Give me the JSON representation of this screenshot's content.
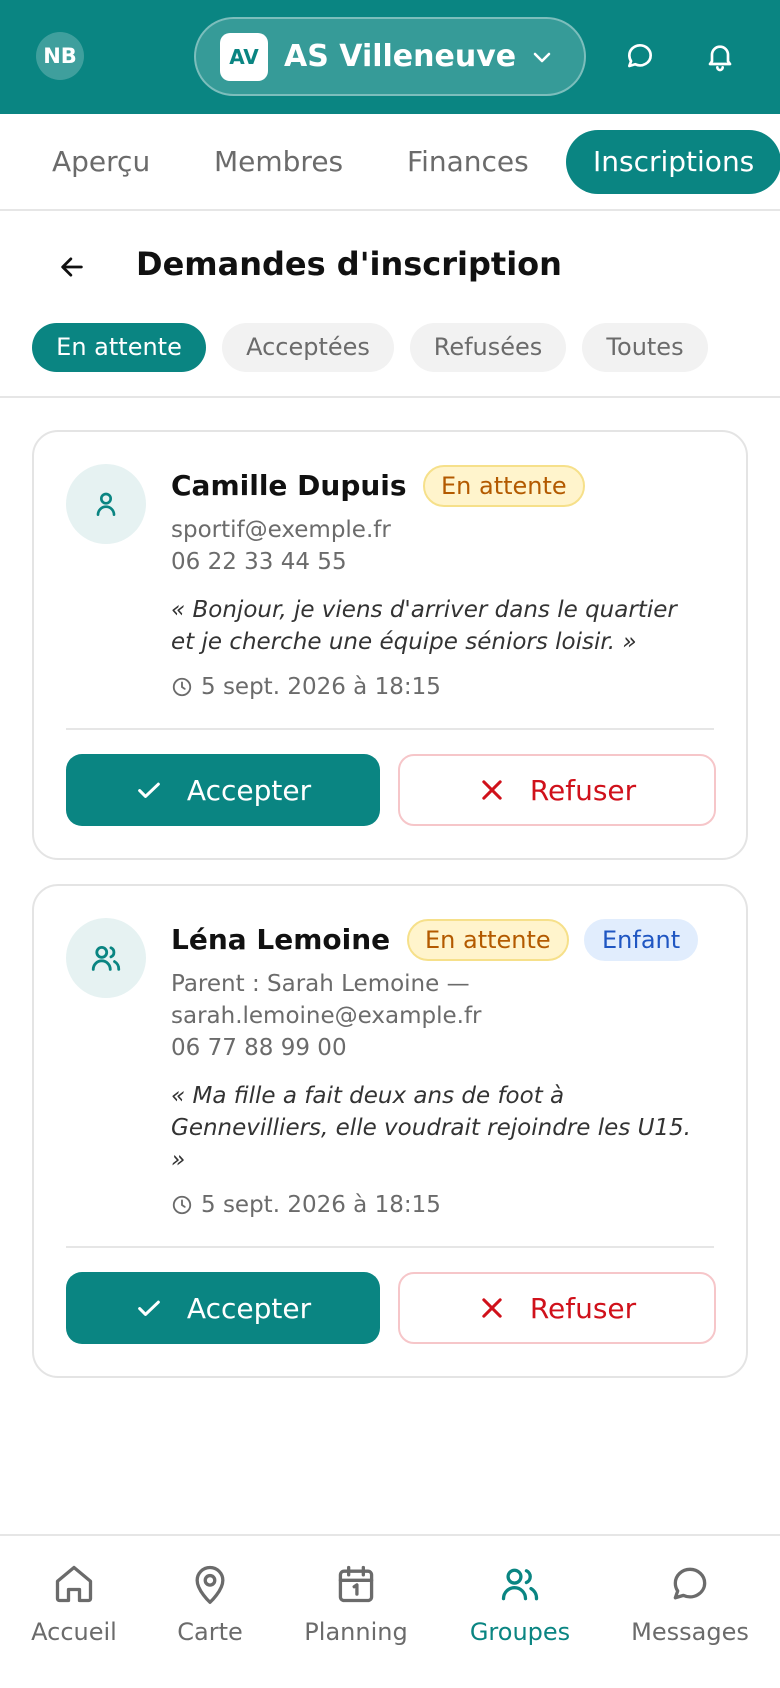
{
  "header": {
    "user_initials": "NB",
    "club_logo_text": "AV",
    "club_name": "AS Villeneuve"
  },
  "tabs": [
    {
      "label": "Aperçu"
    },
    {
      "label": "Membres"
    },
    {
      "label": "Finances"
    },
    {
      "label": "Inscriptions",
      "active": true
    }
  ],
  "page": {
    "title": "Demandes d'inscription"
  },
  "filters": [
    {
      "label": "En attente",
      "active": true
    },
    {
      "label": "Acceptées"
    },
    {
      "label": "Refusées"
    },
    {
      "label": "Toutes"
    }
  ],
  "requests": [
    {
      "name": "Camille Dupuis",
      "status": "En attente",
      "email": "sportif@exemple.fr",
      "phone": "06 22 33 44 55",
      "message_line1": "« Bonjour, je viens d'arriver dans le quartier",
      "message_line2": "et je cherche une équipe séniors loisir. »",
      "date": "5 sept. 2026 à 18:15",
      "accept_label": "Accepter",
      "refuse_label": "Refuser"
    },
    {
      "name": "Léna Lemoine",
      "status": "En attente",
      "type_badge": "Enfant",
      "parent_line": "Parent : Sarah Lemoine —",
      "email": "sarah.lemoine@example.fr",
      "phone": "06 77 88 99 00",
      "message_line1": "« Ma fille a fait deux ans de foot à",
      "message_line2": "Gennevilliers, elle voudrait rejoindre les U15.",
      "message_line3": "»",
      "date": "5 sept. 2026 à 18:15",
      "accept_label": "Accepter",
      "refuse_label": "Refuser"
    }
  ],
  "bottom_nav": [
    {
      "label": "Accueil",
      "icon": "home-icon"
    },
    {
      "label": "Carte",
      "icon": "map-pin-icon"
    },
    {
      "label": "Planning",
      "icon": "calendar-icon"
    },
    {
      "label": "Groupes",
      "icon": "users-icon",
      "active": true
    },
    {
      "label": "Messages",
      "icon": "chat-icon"
    }
  ],
  "colors": {
    "brand": "#0a8582",
    "pending_bg": "#fff4cc",
    "pending_text": "#b35a00",
    "child_bg": "#e1edfd",
    "child_text": "#1f56c2",
    "refuse": "#d0111b"
  }
}
